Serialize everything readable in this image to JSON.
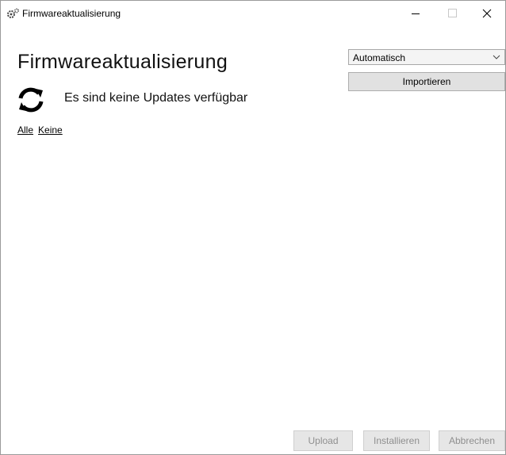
{
  "window": {
    "title": "Firmwareaktualisierung",
    "icons": {
      "app": "gears-icon",
      "minimize": "minimize-icon",
      "maximize": "maximize-icon",
      "close": "close-icon"
    }
  },
  "main": {
    "heading": "Firmwareaktualisierung",
    "status_icon": "refresh-icon",
    "status_text": "Es sind keine Updates verfügbar",
    "links": {
      "all": "Alle",
      "none": "Keine"
    }
  },
  "controls": {
    "mode_select": {
      "value": "Automatisch",
      "icon": "chevron-down-icon"
    },
    "import_label": "Importieren"
  },
  "footer": {
    "upload_label": "Upload",
    "install_label": "Installieren",
    "cancel_label": "Abbrechen"
  },
  "colors": {
    "disabled_text": "#8f8f8f",
    "button_bg": "#e1e1e1"
  }
}
